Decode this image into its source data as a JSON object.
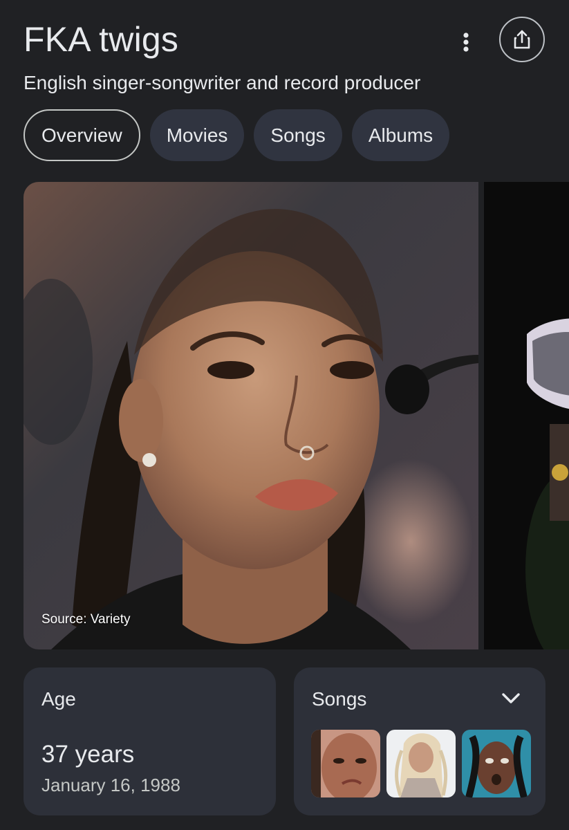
{
  "header": {
    "title": "FKA twigs",
    "subtitle": "English singer-songwriter and record producer",
    "more_icon": "more-vert-icon",
    "share_icon": "share-icon"
  },
  "tabs": [
    {
      "label": "Overview",
      "active": true
    },
    {
      "label": "Movies",
      "active": false
    },
    {
      "label": "Songs",
      "active": false
    },
    {
      "label": "Albums",
      "active": false
    }
  ],
  "images": {
    "main_source": "Source: Variety"
  },
  "age_card": {
    "label": "Age",
    "value": "37 years",
    "birth_date": "January 16, 1988"
  },
  "songs_card": {
    "label": "Songs",
    "expand_icon": "chevron-down-icon"
  },
  "colors": {
    "background": "#202124",
    "card": "#2d3039",
    "chip": "#303440",
    "text": "#e8eaed"
  }
}
